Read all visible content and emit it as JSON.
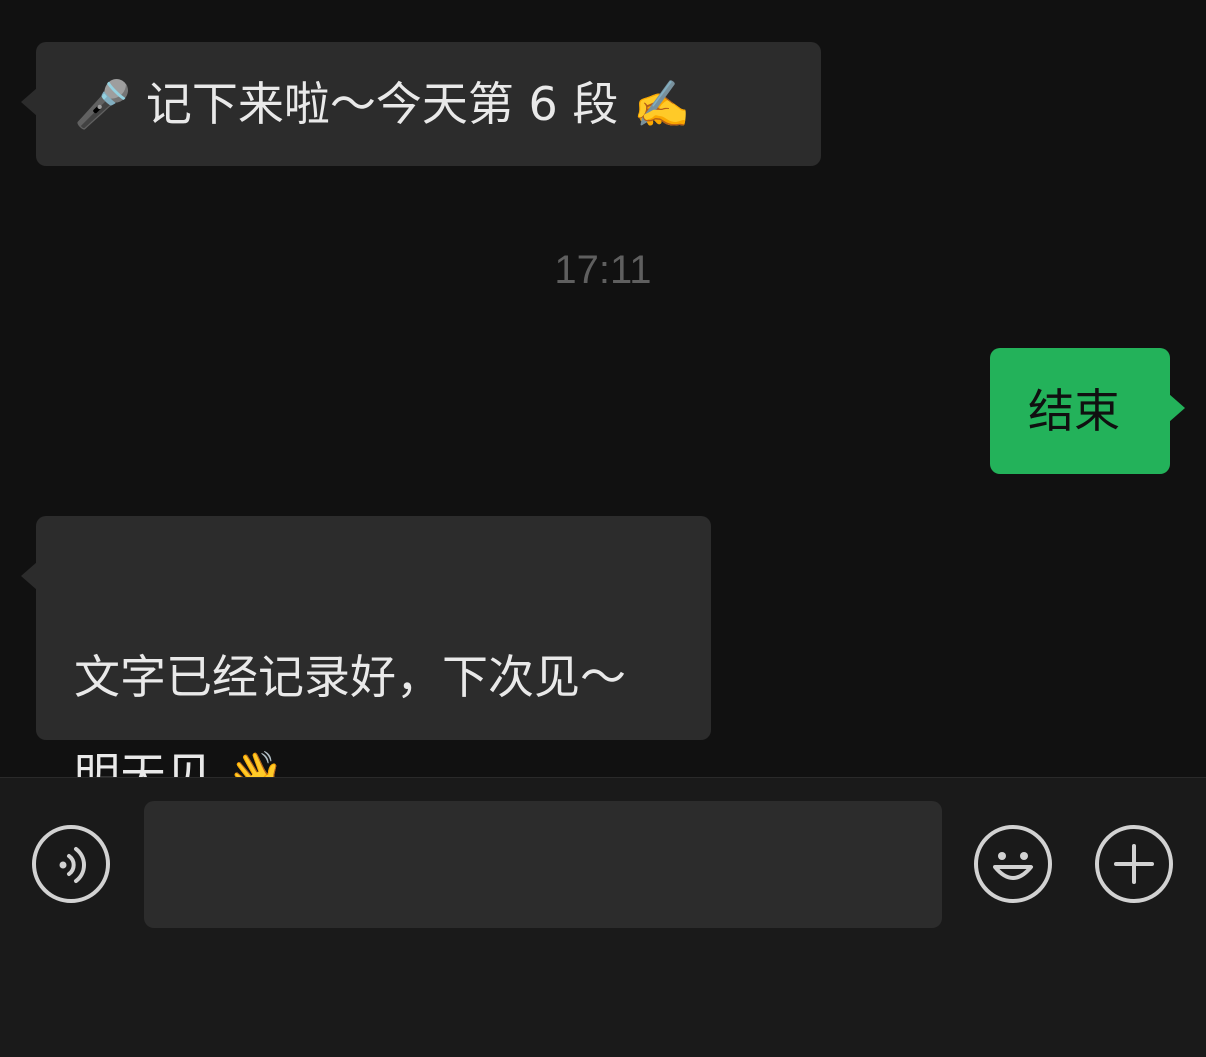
{
  "chat": {
    "messages": [
      {
        "direction": "incoming",
        "text": "🎤 记下来啦～今天第 6 段 ✍️"
      },
      {
        "direction": "outgoing",
        "text": "结束"
      },
      {
        "direction": "incoming",
        "text": "文字已经记录好，下次见～\n明天见 👋"
      }
    ],
    "timestamp": "17:11"
  },
  "input_bar": {
    "voice_icon": "voice-input-icon",
    "input_value": "",
    "emoji_icon": "smiley-face-icon",
    "plus_icon": "plus-icon"
  },
  "colors": {
    "background": "#111111",
    "incoming_bubble": "#2c2c2c",
    "outgoing_bubble": "#23b25a",
    "input_bar": "#1a1a1a"
  }
}
